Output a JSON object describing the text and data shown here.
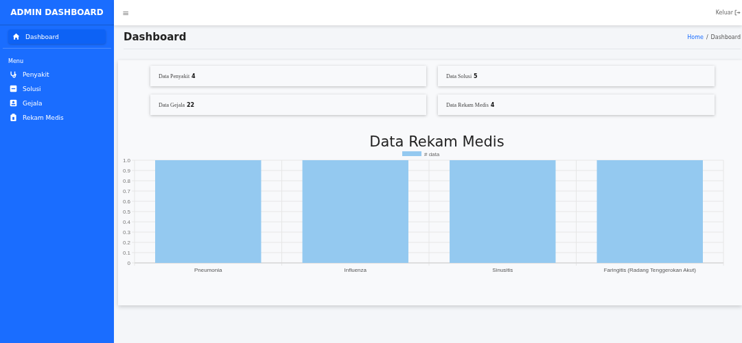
{
  "sidebar": {
    "brand": "ADMIN DASHBOARD",
    "items": [
      {
        "label": "Dashboard",
        "selected": true
      }
    ],
    "section": "Menu",
    "menu": [
      {
        "label": "Penyakit",
        "selected": false
      },
      {
        "label": "Solusi",
        "selected": false
      },
      {
        "label": "Gejala",
        "selected": false
      },
      {
        "label": "Rekam Medis",
        "selected": false
      }
    ]
  },
  "topbar": {
    "menu_glyph": "≡",
    "logout": "Keluar"
  },
  "page": {
    "title": "Dashboard",
    "breadcrumb": [
      {
        "label": "Home",
        "link": true
      },
      {
        "label": "Dashboard",
        "link": false
      }
    ],
    "separator": "/"
  },
  "stats": [
    {
      "label": "Data Penyakit",
      "value": "4"
    },
    {
      "label": "Data Solusi",
      "value": "5"
    },
    {
      "label": "Data Gejala",
      "value": "22"
    },
    {
      "label": "Data Rekam Medis",
      "value": "4"
    }
  ],
  "chart": {
    "chart_data": {
      "type": "bar",
      "title": "Data Rekam Medis",
      "categories": [
        "Pneumonia",
        "Influenza",
        "Sinusitis",
        "Faringitis (Radang Tenggerokan Akut)"
      ],
      "series": [
        {
          "name": "# data",
          "color": "#94c9f0",
          "values": [
            1,
            1,
            1,
            1
          ]
        }
      ],
      "grid": true,
      "ylim": [
        0,
        1
      ],
      "yticks": [
        {
          "value": 0,
          "label": "0"
        },
        {
          "value": 0.1,
          "label": "0.1"
        },
        {
          "value": 0.2,
          "label": "0.2"
        },
        {
          "value": 0.3,
          "label": "0.3"
        },
        {
          "value": 0.4,
          "label": "0.4"
        },
        {
          "value": 0.5,
          "label": "0.5"
        },
        {
          "value": 0.6,
          "label": "0.6"
        },
        {
          "value": 0.7,
          "label": "0.7"
        },
        {
          "value": 0.8,
          "label": "0.8"
        },
        {
          "value": 0.9,
          "label": "0.9"
        },
        {
          "value": 1,
          "label": "1.0"
        }
      ]
    }
  }
}
